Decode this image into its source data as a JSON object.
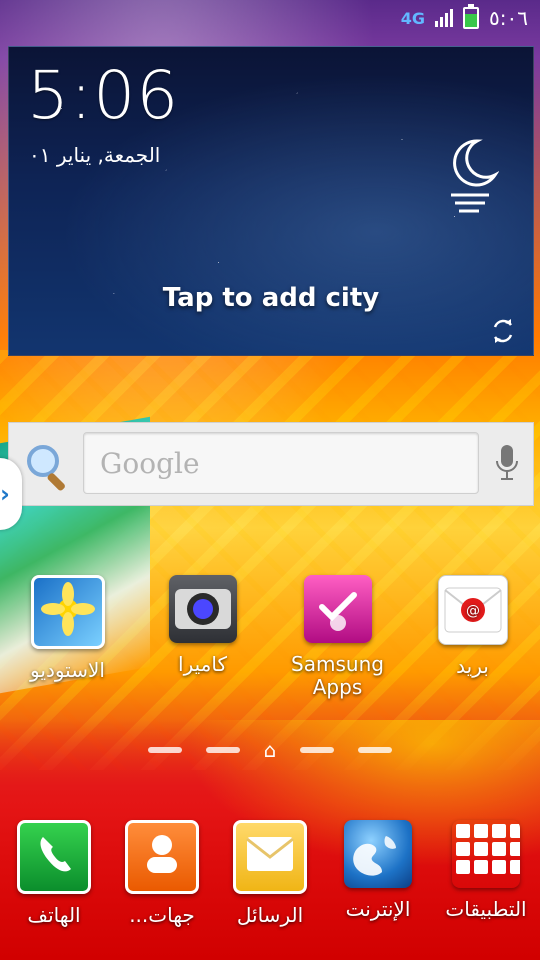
{
  "status_bar": {
    "network": "4G",
    "time": "٥:٠٦",
    "battery_level_percent": 75
  },
  "weather_widget": {
    "time": "5:06",
    "date": "الجمعة, يناير ٠١",
    "tap_hint": "Tap to add city",
    "icons": [
      "moon-icon",
      "refresh-icon"
    ]
  },
  "search_bar": {
    "placeholder": "Google",
    "icons": [
      "magnifier-icon",
      "mic-icon"
    ]
  },
  "side_handle": {
    "glyph": "›"
  },
  "home_apps": [
    {
      "label": "الاستوديو",
      "icon": "gallery-icon"
    },
    {
      "label": "كاميرا",
      "icon": "camera-icon"
    },
    {
      "label": "Samsung Apps",
      "icon": "samsung-apps-icon"
    },
    {
      "label": "بريد",
      "icon": "email-icon"
    }
  ],
  "pager": {
    "home_glyph": "⌂"
  },
  "dock": [
    {
      "label": "الهاتف",
      "icon": "phone-icon"
    },
    {
      "label": "جهات...",
      "icon": "contacts-icon"
    },
    {
      "label": "الرسائل",
      "icon": "messages-icon"
    },
    {
      "label": "الإنترنت",
      "icon": "internet-icon"
    },
    {
      "label": "التطبيقات",
      "icon": "apps-grid-icon"
    }
  ]
}
